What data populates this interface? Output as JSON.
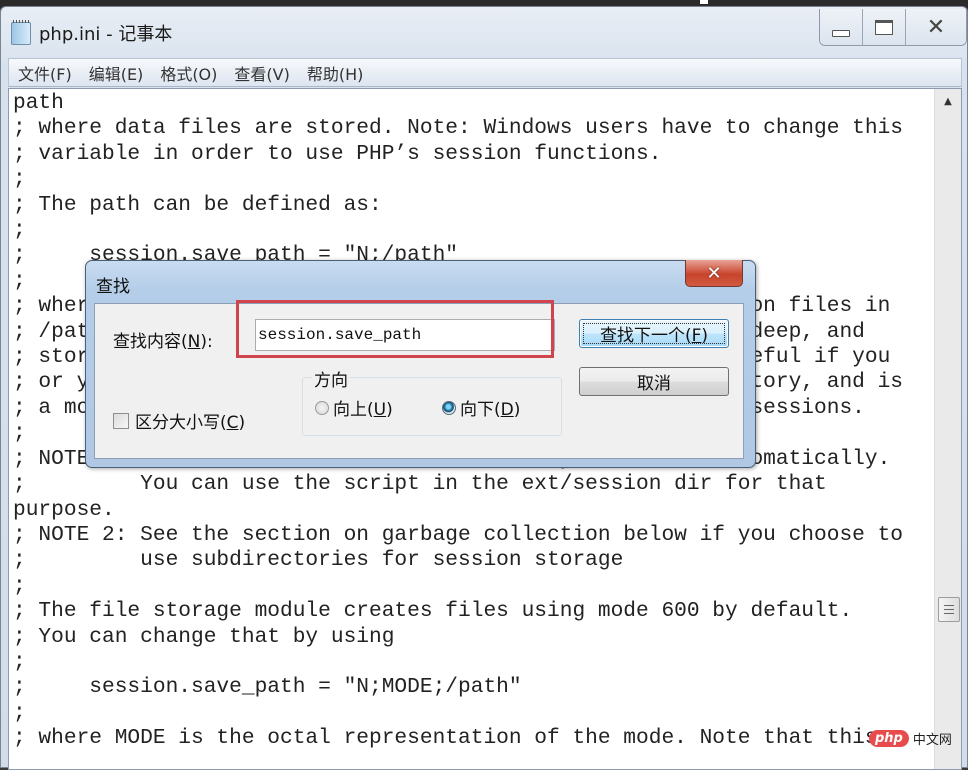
{
  "window": {
    "title": "php.ini - 记事本",
    "caption_buttons": [
      "minimize",
      "maximize",
      "close"
    ]
  },
  "menubar": {
    "items": [
      {
        "label": "文件(F)"
      },
      {
        "label": "编辑(E)"
      },
      {
        "label": "格式(O)"
      },
      {
        "label": "查看(V)"
      },
      {
        "label": "帮助(H)"
      }
    ]
  },
  "editor": {
    "lines": [
      "path",
      "; where data files are stored. Note: Windows users have to change this",
      "; variable in order to use PHP’s session functions.",
      ";",
      "; The path can be defined as:",
      ";",
      ";     session.save_path = \"N;/path\"",
      ";",
      "; where N is an integer.  Instead of storing all the session files in",
      "; /path, what this will do is use subdirectories N-levels deep, and",
      "; store the session data in those directories.  This is useful if you",
      "; or your OS have problems with lots of files in one directory, and is",
      "; a more efficient layout for servers that handle lots of sessions.",
      ";",
      "; NOTE 1: PHP will not create this directory structure automatically.",
      ";         You can use the script in the ext/session dir for that",
      "purpose.",
      "; NOTE 2: See the section on garbage collection below if you choose to",
      ";         use subdirectories for session storage",
      ";",
      "; The file storage module creates files using mode 600 by default.",
      "; You can change that by using",
      ";",
      ";     session.save_path = \"N;MODE;/path\"",
      ";",
      "; where MODE is the octal representation of the mode. Note that this"
    ]
  },
  "find_dialog": {
    "title": "查找",
    "find_what_label": "查找内容(N):",
    "find_what_value": "session.save_path",
    "find_next_label": "查找下一个(F)",
    "cancel_label": "取消",
    "direction_legend": "方向",
    "direction_up_label": "向上(U)",
    "direction_down_label": "向下(D)",
    "direction_selected": "down",
    "match_case_label": "区分大小写(C)",
    "match_case_checked": false,
    "highlight_color": "#d0454d"
  },
  "watermark": {
    "brand": "php",
    "suffix": "中文网"
  }
}
